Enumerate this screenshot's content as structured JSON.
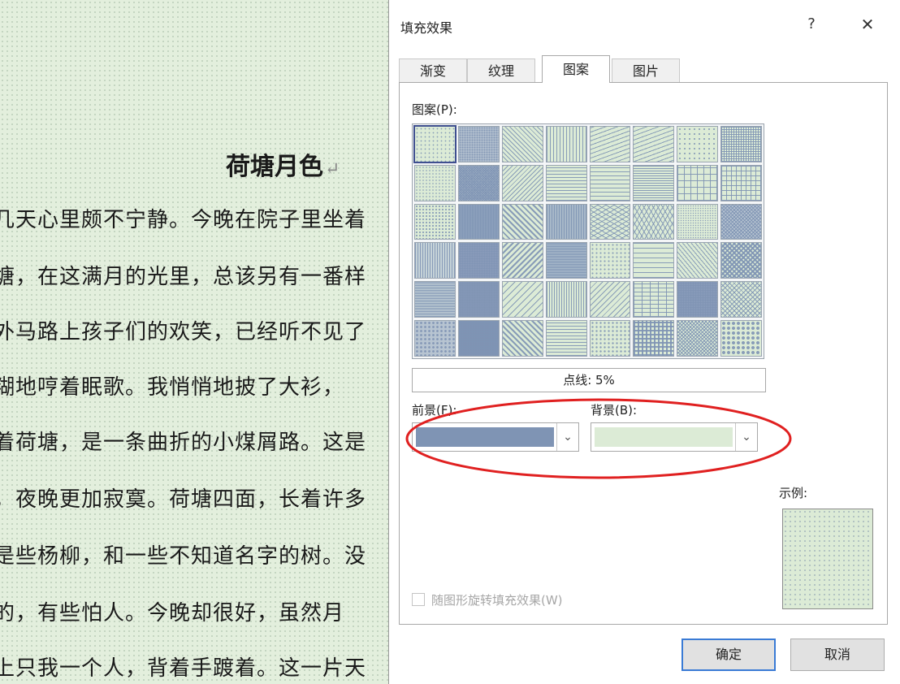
{
  "document": {
    "title": "荷塘月色",
    "paragraph_mark": "↵",
    "lines": [
      "几天心里颇不宁静。今晚在院子里坐着",
      "塘，在这满月的光里，总该另有一番样",
      "外马路上孩子们的欢笑，已经听不见了",
      "糊地哼着眠歌。我悄悄地披了大衫，",
      "着荷塘，是一条曲折的小煤屑路。这是",
      "，夜晚更加寂寞。荷塘四面，长着许多",
      "是些杨柳，和一些不知道名字的树。没",
      "的，有些怕人。今晚却很好，虽然月",
      "上只我一个人，背着手踱着。这一片天"
    ]
  },
  "dialog": {
    "title": "填充效果",
    "help_label": "?",
    "close_label": "✕",
    "tabs": [
      {
        "label": "渐变",
        "active": false
      },
      {
        "label": "纹理",
        "active": false
      },
      {
        "label": "图案",
        "active": true
      },
      {
        "label": "图片",
        "active": false
      }
    ],
    "pattern_label": "图案(P):",
    "selected_pattern_name": "点线: 5%",
    "foreground_label": "前景(F):",
    "background_label": "背景(B):",
    "foreground_color": "#7f94b4",
    "background_color": "#dcebd6",
    "dropdown_icon": "chevron-down-icon",
    "sample_label": "示例:",
    "rotate_checkbox_label": "随图形旋转填充效果(W)",
    "rotate_checked": false,
    "rotate_enabled": false,
    "ok_label": "确定",
    "cancel_label": "取消",
    "annotation_color": "#e02020"
  }
}
